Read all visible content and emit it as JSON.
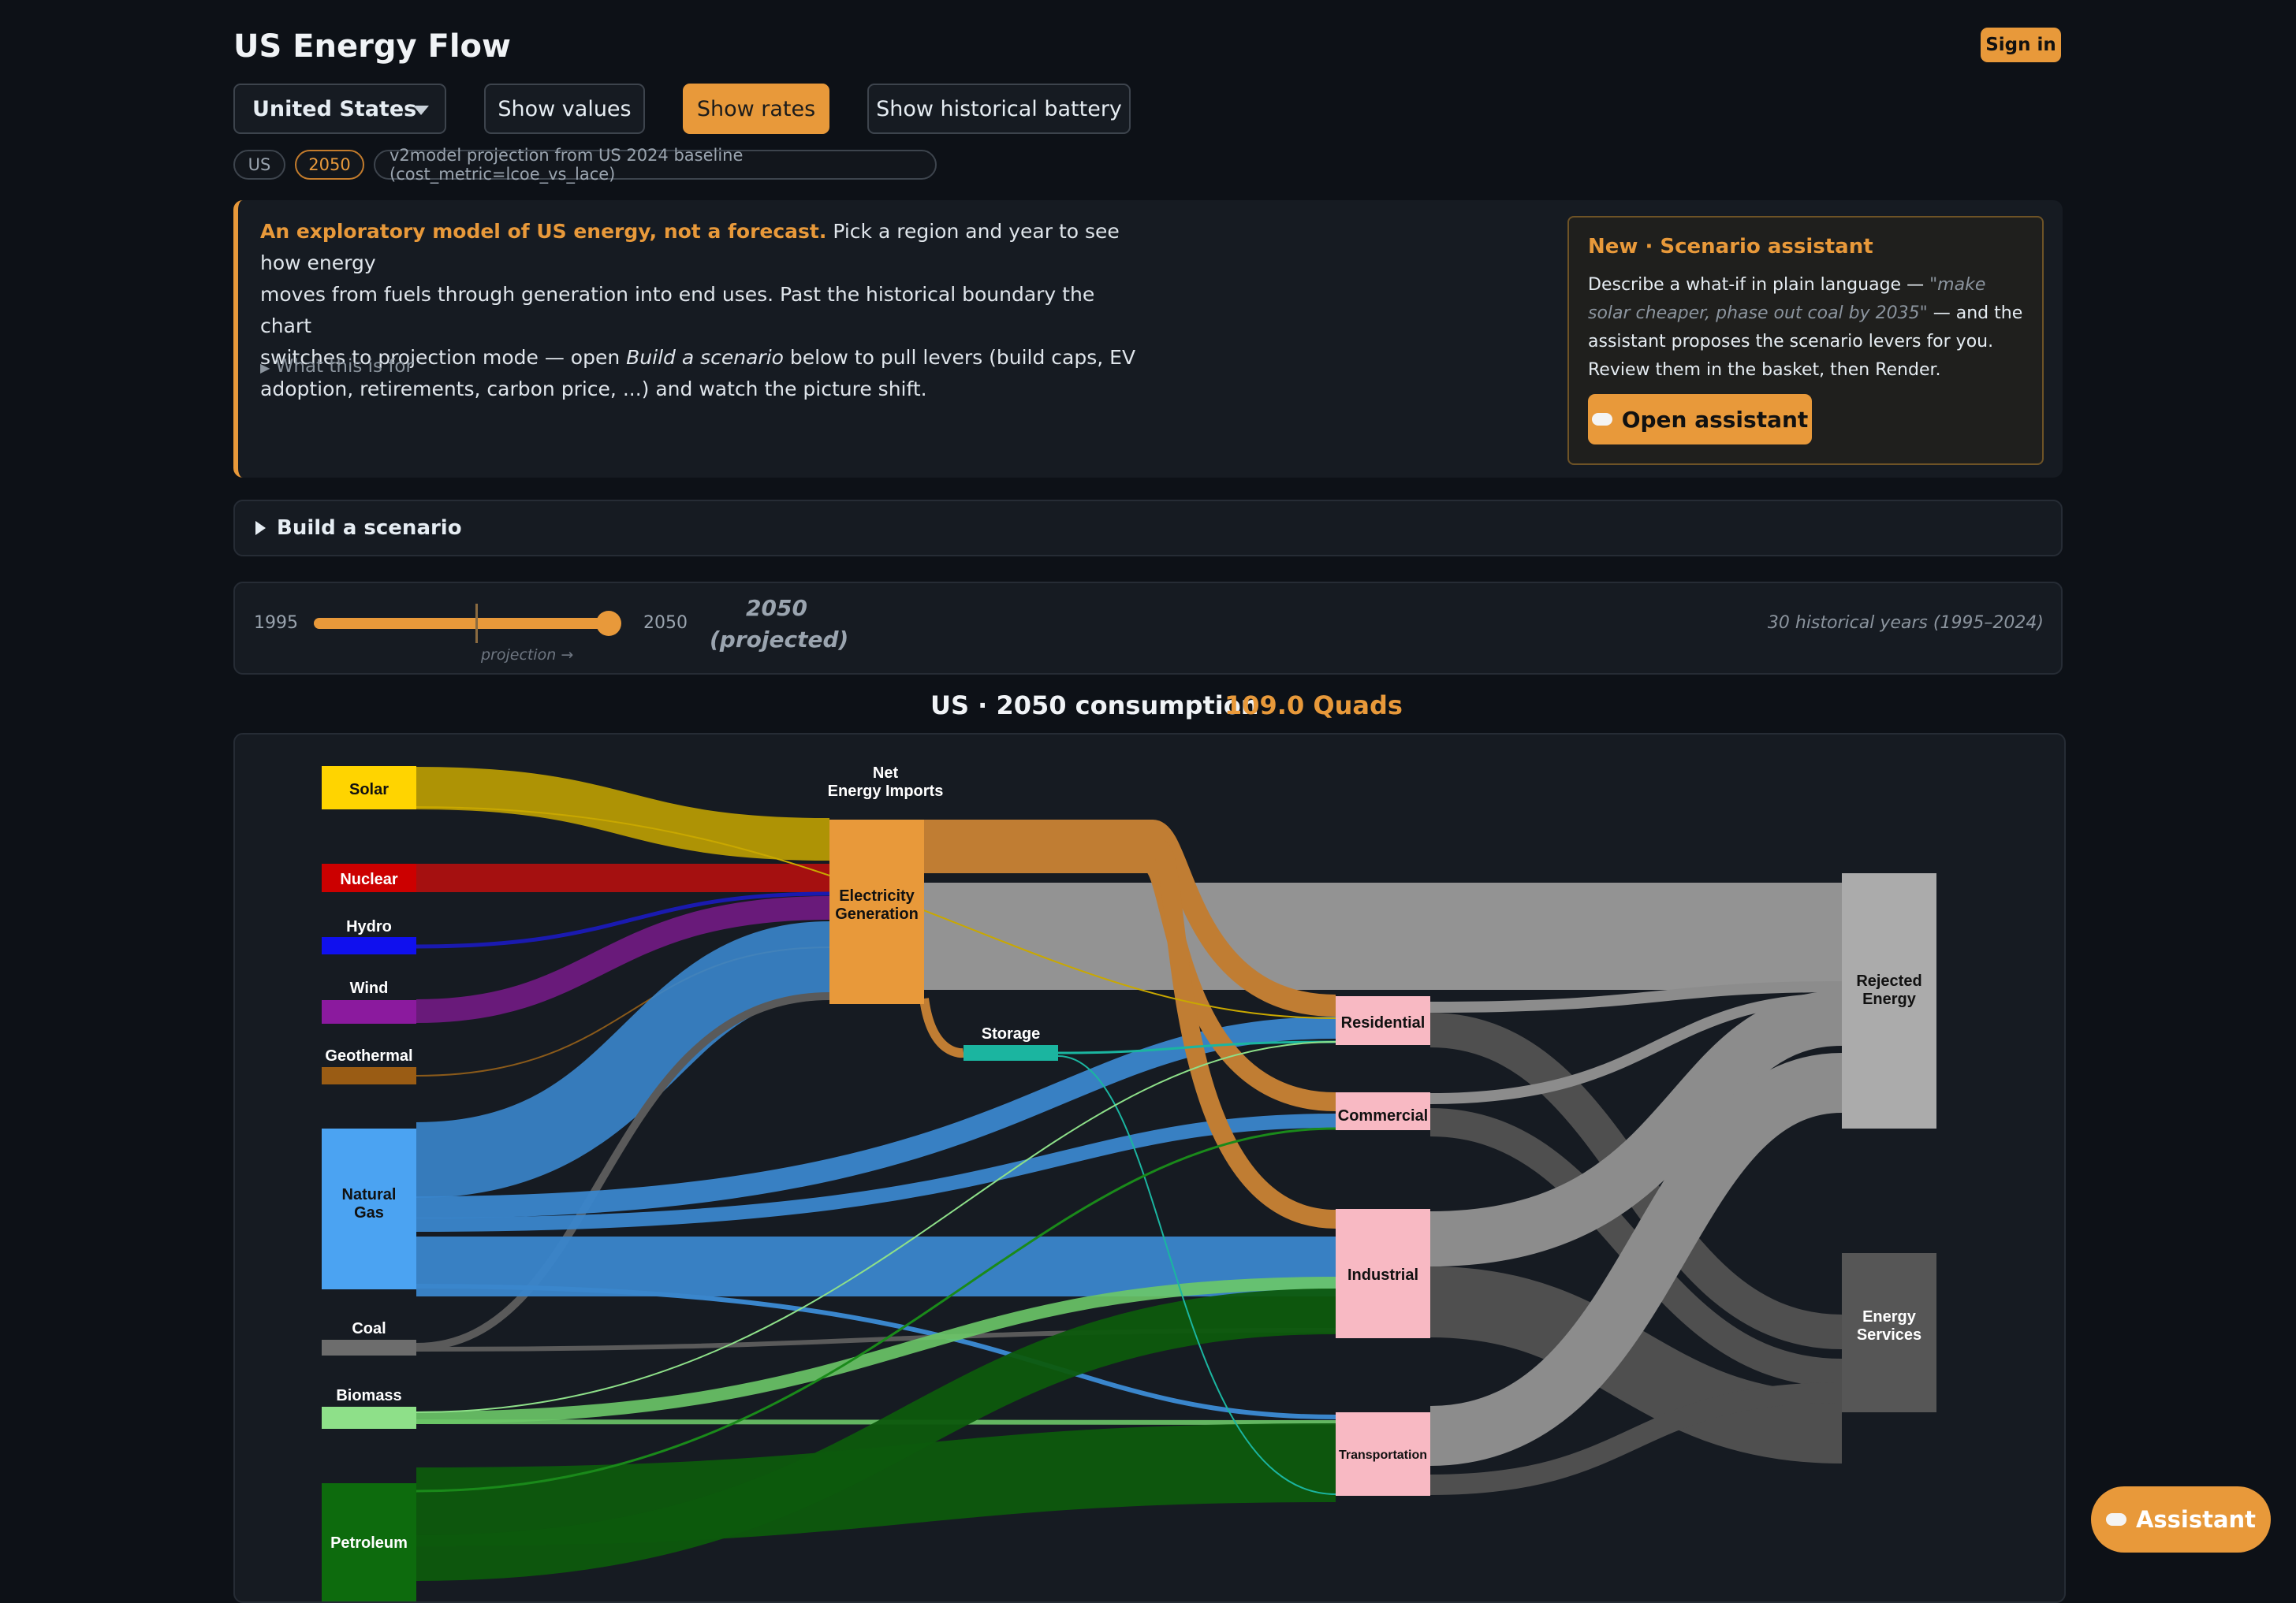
{
  "app": {
    "title": "US Energy Flow",
    "sign_in": "Sign in"
  },
  "controls": {
    "region": "United States",
    "show_values": "Show values",
    "show_rates": "Show rates",
    "show_battery": "Show historical battery"
  },
  "chips": {
    "region": "US",
    "year": "2050",
    "model": "v2model projection from US 2024 baseline (cost_metric=lcoe_vs_lace)"
  },
  "intro": {
    "lead": "An exploratory model of US energy, not a forecast.",
    "line1_rest": " Pick a region and year to see how energy",
    "line2": "moves from fuels through generation into end uses. Past the historical boundary the chart",
    "line3a": "switches to projection mode — open ",
    "line3_em": "Build a scenario",
    "line3b": " below to pull levers (build caps, EV",
    "line4": "adoption, retirements, carbon price, ...) and watch the picture shift.",
    "what_for": "What this is for"
  },
  "assistant_box": {
    "heading": "New · Scenario assistant",
    "p1": "Describe a what-if in plain language — ",
    "example": "\"make solar cheaper, phase out coal by 2035\"",
    "p2": " — and the assistant proposes the scenario levers for you. Review them in the basket, then Render.",
    "button": "Open assistant"
  },
  "build": {
    "label": "Build a scenario"
  },
  "timeline": {
    "min": "1995",
    "max": "2050",
    "year": "2050",
    "year_note": "(projected)",
    "projection_label": "projection →",
    "historical_note": "30 historical years (1995–2024)",
    "value": 2050,
    "historical_end": 2024
  },
  "summary": {
    "heading": "US · 2050 consumption",
    "total": "109.0 Quads"
  },
  "colors": {
    "accent": "#e8993a",
    "solar": "#ffd400",
    "nuclear": "#cc0000",
    "hydro": "#1010ee",
    "wind": "#8b1a9e",
    "geothermal": "#9a5c14",
    "natural_gas": "#4ba3f2",
    "coal": "#6d6d6d",
    "biomass": "#8ee089",
    "petroleum": "#0d6b0d",
    "electricity": "#e8993a",
    "storage": "#1bb5a0",
    "sector": "#f8b9c3",
    "rejected": "#ababab",
    "services": "#565656"
  },
  "sankey": {
    "sources": [
      {
        "id": "solar",
        "label": "Solar"
      },
      {
        "id": "nuclear",
        "label": "Nuclear"
      },
      {
        "id": "hydro",
        "label": "Hydro"
      },
      {
        "id": "wind",
        "label": "Wind"
      },
      {
        "id": "geothermal",
        "label": "Geothermal"
      },
      {
        "id": "natural_gas",
        "label": "Natural Gas"
      },
      {
        "id": "coal",
        "label": "Coal"
      },
      {
        "id": "biomass",
        "label": "Biomass"
      },
      {
        "id": "petroleum",
        "label": "Petroleum"
      }
    ],
    "hubs": [
      {
        "id": "net_imports",
        "label": "Net Energy Imports"
      },
      {
        "id": "electricity",
        "label": "Electricity Generation"
      },
      {
        "id": "storage",
        "label": "Storage"
      }
    ],
    "sectors": [
      {
        "id": "residential",
        "label": "Residential"
      },
      {
        "id": "commercial",
        "label": "Commercial"
      },
      {
        "id": "industrial",
        "label": "Industrial"
      },
      {
        "id": "transportation",
        "label": "Transportation"
      }
    ],
    "sinks": [
      {
        "id": "rejected",
        "label": "Rejected Energy"
      },
      {
        "id": "services",
        "label": "Energy Services"
      }
    ]
  },
  "fab": {
    "label": "Assistant"
  }
}
